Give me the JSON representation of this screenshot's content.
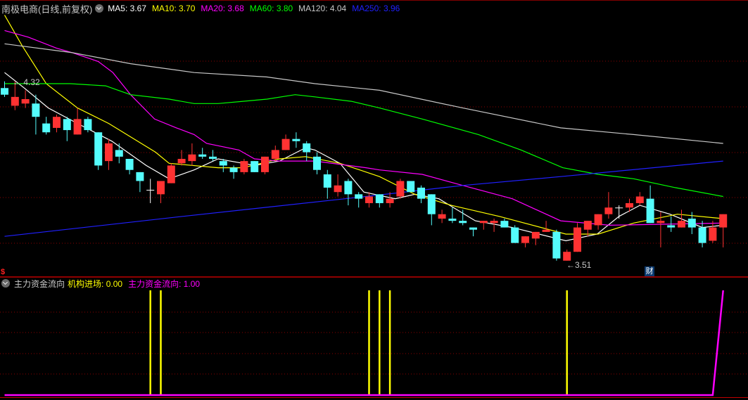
{
  "header": {
    "title": "南极电商(日线,前复权)",
    "ma": [
      {
        "label": "MA5",
        "value": "3.67",
        "color": "#ffffff"
      },
      {
        "label": "MA10",
        "value": "3.70",
        "color": "#ffff00"
      },
      {
        "label": "MA20",
        "value": "3.68",
        "color": "#ff00ff"
      },
      {
        "label": "MA60",
        "value": "3.80",
        "color": "#00ff00"
      },
      {
        "label": "MA120",
        "value": "4.04",
        "color": "#c8c8c8"
      },
      {
        "label": "MA250",
        "value": "3.96",
        "color": "#2020ff"
      }
    ]
  },
  "sub_header": {
    "title": "主力资金流向",
    "items": [
      {
        "label": "机构进场",
        "value": "0.00",
        "color": "#ffff00"
      },
      {
        "label": "主力资金流向",
        "value": "1.00",
        "color": "#ff00ff"
      }
    ]
  },
  "annotations": {
    "high_label": "4.32",
    "low_label": "3.51",
    "arrow": "←",
    "badge": "财",
    "marker": "$"
  },
  "colors": {
    "up": "#ff3232",
    "down": "#54fcfc",
    "doji": "#ffffff",
    "grid": "#8b0000",
    "separator": "#c00000"
  },
  "chart_data": [
    {
      "type": "candlestick",
      "title": "南极电商(日线,前复权)",
      "ylim": [
        3.449,
        4.618
      ],
      "grid": true,
      "ohlc": [
        [
          4.29,
          4.32,
          4.25,
          4.26
        ],
        [
          4.21,
          4.32,
          4.19,
          4.25
        ],
        [
          4.22,
          4.28,
          4.2,
          4.24
        ],
        [
          4.22,
          4.26,
          4.08,
          4.16
        ],
        [
          4.13,
          4.16,
          4.08,
          4.09
        ],
        [
          4.11,
          4.17,
          4.09,
          4.16
        ],
        [
          4.15,
          4.16,
          4.05,
          4.1
        ],
        [
          4.08,
          4.2,
          4.08,
          4.15
        ],
        [
          4.15,
          4.16,
          4.09,
          4.1
        ],
        [
          4.09,
          4.09,
          3.92,
          3.94
        ],
        [
          3.96,
          4.06,
          3.92,
          4.04
        ],
        [
          4.01,
          4.04,
          3.95,
          3.98
        ],
        [
          3.97,
          3.97,
          3.9,
          3.92
        ],
        [
          3.91,
          3.91,
          3.82,
          3.87
        ],
        [
          3.83,
          3.88,
          3.77,
          3.83
        ],
        [
          3.81,
          3.87,
          3.77,
          3.87
        ],
        [
          3.86,
          3.95,
          3.86,
          3.94
        ],
        [
          3.95,
          4.01,
          3.94,
          3.97
        ],
        [
          3.96,
          4.04,
          3.94,
          3.99
        ],
        [
          3.99,
          4.02,
          3.97,
          3.98
        ],
        [
          3.98,
          4.01,
          3.96,
          3.97
        ],
        [
          3.96,
          3.97,
          3.91,
          3.94
        ],
        [
          3.93,
          3.94,
          3.88,
          3.91
        ],
        [
          3.91,
          3.97,
          3.9,
          3.96
        ],
        [
          3.96,
          3.96,
          3.91,
          3.91
        ],
        [
          3.91,
          3.98,
          3.9,
          3.98
        ],
        [
          3.97,
          4.03,
          3.96,
          4.01
        ],
        [
          4.01,
          4.08,
          4.01,
          4.06
        ],
        [
          4.06,
          4.09,
          4.02,
          4.05
        ],
        [
          4.04,
          4.05,
          3.96,
          4.0
        ],
        [
          3.98,
          4.0,
          3.9,
          3.92
        ],
        [
          3.9,
          3.92,
          3.79,
          3.84
        ],
        [
          3.82,
          3.9,
          3.8,
          3.85
        ],
        [
          3.87,
          3.88,
          3.76,
          3.81
        ],
        [
          3.81,
          3.82,
          3.75,
          3.79
        ],
        [
          3.77,
          3.82,
          3.75,
          3.8
        ],
        [
          3.81,
          3.81,
          3.75,
          3.77
        ],
        [
          3.77,
          3.82,
          3.75,
          3.79
        ],
        [
          3.8,
          3.88,
          3.79,
          3.87
        ],
        [
          3.87,
          3.87,
          3.82,
          3.82
        ],
        [
          3.84,
          3.85,
          3.77,
          3.79
        ],
        [
          3.81,
          3.81,
          3.67,
          3.72
        ],
        [
          3.7,
          3.74,
          3.68,
          3.72
        ],
        [
          3.7,
          3.75,
          3.68,
          3.69
        ],
        [
          3.69,
          3.74,
          3.67,
          3.68
        ],
        [
          3.66,
          3.66,
          3.62,
          3.65
        ],
        [
          3.68,
          3.69,
          3.65,
          3.69
        ],
        [
          3.68,
          3.7,
          3.64,
          3.69
        ],
        [
          3.69,
          3.7,
          3.66,
          3.66
        ],
        [
          3.66,
          3.67,
          3.59,
          3.59
        ],
        [
          3.59,
          3.62,
          3.57,
          3.62
        ],
        [
          3.61,
          3.64,
          3.58,
          3.64
        ],
        [
          3.64,
          3.69,
          3.64,
          3.65
        ],
        [
          3.64,
          3.65,
          3.51,
          3.52
        ],
        [
          3.51,
          3.56,
          3.51,
          3.55
        ],
        [
          3.55,
          3.68,
          3.55,
          3.66
        ],
        [
          3.65,
          3.69,
          3.62,
          3.69
        ],
        [
          3.67,
          3.72,
          3.65,
          3.72
        ],
        [
          3.72,
          3.82,
          3.7,
          3.75
        ],
        [
          3.75,
          3.76,
          3.7,
          3.75
        ],
        [
          3.75,
          3.79,
          3.73,
          3.77
        ],
        [
          3.77,
          3.82,
          3.76,
          3.8
        ],
        [
          3.79,
          3.85,
          3.68,
          3.68
        ],
        [
          3.68,
          3.73,
          3.57,
          3.69
        ],
        [
          3.67,
          3.71,
          3.64,
          3.66
        ],
        [
          3.66,
          3.74,
          3.66,
          3.69
        ],
        [
          3.7,
          3.73,
          3.63,
          3.66
        ],
        [
          3.66,
          3.69,
          3.57,
          3.59
        ],
        [
          3.6,
          3.69,
          3.59,
          3.66
        ],
        [
          3.66,
          3.72,
          3.57,
          3.72
        ]
      ],
      "series": [
        {
          "name": "MA5",
          "color": "#ffffff",
          "points": [
            [
              0,
              4.36
            ],
            [
              1.9,
              4.29
            ],
            [
              4.2,
              4.2
            ],
            [
              7,
              4.13
            ],
            [
              10.3,
              4.05
            ],
            [
              13.6,
              3.94
            ],
            [
              15.8,
              3.88
            ],
            [
              18.2,
              3.92
            ],
            [
              20.5,
              3.97
            ],
            [
              22.9,
              3.95
            ],
            [
              24,
              3.94
            ],
            [
              26.4,
              3.96
            ],
            [
              28.9,
              4.02
            ],
            [
              29.8,
              4.01
            ],
            [
              32.2,
              3.95
            ],
            [
              34.5,
              3.82
            ],
            [
              37.5,
              3.79
            ],
            [
              39.4,
              3.81
            ],
            [
              41.7,
              3.79
            ],
            [
              45.2,
              3.69
            ],
            [
              48.75,
              3.66
            ],
            [
              53.9,
              3.6
            ],
            [
              56.9,
              3.63
            ],
            [
              59,
              3.71
            ],
            [
              61,
              3.76
            ],
            [
              63.9,
              3.72
            ],
            [
              67,
              3.66
            ],
            [
              69,
              3.67
            ]
          ]
        },
        {
          "name": "MA10",
          "color": "#ffff00",
          "points": [
            [
              0,
              4.62
            ],
            [
              1.7,
              4.48
            ],
            [
              4,
              4.31
            ],
            [
              7,
              4.2
            ],
            [
              10,
              4.13
            ],
            [
              14.5,
              4.0
            ],
            [
              15.8,
              3.95
            ],
            [
              20.5,
              3.93
            ],
            [
              22.9,
              3.93
            ],
            [
              26.4,
              3.97
            ],
            [
              28.9,
              3.98
            ],
            [
              32.2,
              3.95
            ],
            [
              36,
              3.89
            ],
            [
              39.4,
              3.81
            ],
            [
              42.9,
              3.76
            ],
            [
              47.5,
              3.71
            ],
            [
              53.9,
              3.63
            ],
            [
              57,
              3.63
            ],
            [
              60.4,
              3.68
            ],
            [
              64.6,
              3.72
            ],
            [
              69,
              3.7
            ]
          ]
        },
        {
          "name": "MA20",
          "color": "#ff00ff",
          "points": [
            [
              0,
              4.55
            ],
            [
              2.3,
              4.52
            ],
            [
              5,
              4.47
            ],
            [
              6.5,
              4.45
            ],
            [
              9,
              4.41
            ],
            [
              10.4,
              4.36
            ],
            [
              12.1,
              4.26
            ],
            [
              14.4,
              4.15
            ],
            [
              16.5,
              4.11
            ],
            [
              18.2,
              4.08
            ],
            [
              19.4,
              4.04
            ],
            [
              22.5,
              4.01
            ],
            [
              24,
              3.97
            ],
            [
              26.4,
              3.96
            ],
            [
              29.8,
              3.96
            ],
            [
              34.7,
              3.93
            ],
            [
              36,
              3.92
            ],
            [
              40.1,
              3.9
            ],
            [
              44,
              3.85
            ],
            [
              48.75,
              3.79
            ],
            [
              53.4,
              3.69
            ],
            [
              58.1,
              3.67
            ],
            [
              69,
              3.68
            ]
          ]
        },
        {
          "name": "MA60",
          "color": "#00ff00",
          "points": [
            [
              0,
              4.31
            ],
            [
              6.3,
              4.31
            ],
            [
              9.7,
              4.3
            ],
            [
              12.1,
              4.26
            ],
            [
              15.8,
              4.24
            ],
            [
              18.2,
              4.22
            ],
            [
              20.5,
              4.22
            ],
            [
              22.9,
              4.23
            ],
            [
              25.2,
              4.24
            ],
            [
              27.9,
              4.26
            ],
            [
              29.8,
              4.25
            ],
            [
              33.3,
              4.23
            ],
            [
              36,
              4.2
            ],
            [
              40.1,
              4.15
            ],
            [
              45.5,
              4.08
            ],
            [
              49.6,
              4.01
            ],
            [
              53.6,
              3.93
            ],
            [
              57,
              3.9
            ],
            [
              60.4,
              3.88
            ],
            [
              64.4,
              3.84
            ],
            [
              69,
              3.8
            ]
          ]
        },
        {
          "name": "MA120",
          "color": "#c8c8c8",
          "points": [
            [
              0,
              4.49
            ],
            [
              6.5,
              4.45
            ],
            [
              12.1,
              4.4
            ],
            [
              18.2,
              4.36
            ],
            [
              25.2,
              4.34
            ],
            [
              29.8,
              4.31
            ],
            [
              36,
              4.28
            ],
            [
              44,
              4.2
            ],
            [
              53.4,
              4.11
            ],
            [
              60.4,
              4.08
            ],
            [
              69,
              4.04
            ]
          ]
        },
        {
          "name": "MA250",
          "color": "#2020ff",
          "points": [
            [
              0,
              3.62
            ],
            [
              17.1,
              3.71
            ],
            [
              34.7,
              3.8
            ],
            [
              44,
              3.85
            ],
            [
              53.4,
              3.89
            ],
            [
              69,
              3.96
            ]
          ]
        }
      ],
      "high_marker": {
        "index": 0,
        "value": 4.32
      },
      "low_marker": {
        "index": 54,
        "value": 3.51
      },
      "badge_index": 63
    },
    {
      "type": "bar-line",
      "title": "主力资金流向",
      "ylim": [
        0,
        1
      ],
      "grid": true,
      "series": [
        {
          "name": "机构进场",
          "color": "#ffff00",
          "style": "stick",
          "nonzero_indices": [
            14,
            15,
            35,
            36,
            37,
            54
          ],
          "value": 1
        },
        {
          "name": "主力资金流向",
          "color": "#ff00ff",
          "style": "line",
          "points": [
            [
              0,
              0
            ],
            [
              68,
              0
            ],
            [
              69,
              1
            ]
          ]
        }
      ]
    }
  ]
}
